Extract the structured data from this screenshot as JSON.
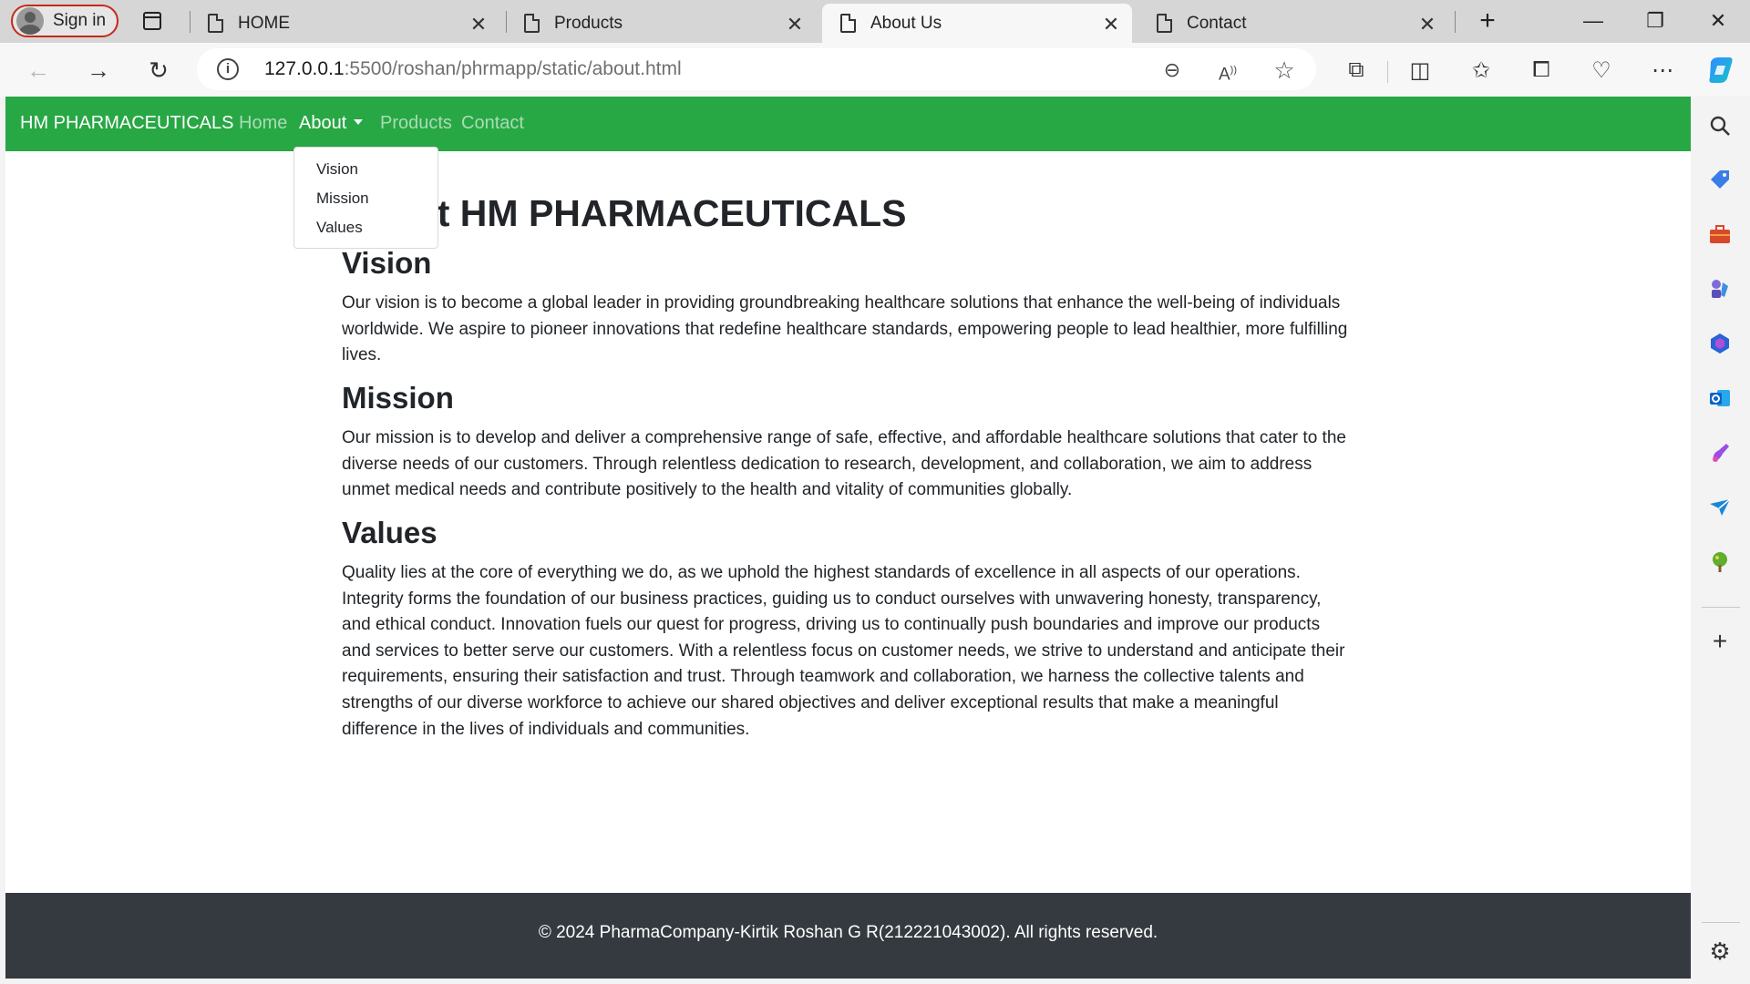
{
  "browser": {
    "profile_label": "Sign in",
    "tabs": [
      {
        "title": "HOME"
      },
      {
        "title": "Products"
      },
      {
        "title": "About Us"
      },
      {
        "title": "Contact"
      }
    ],
    "url_host": "127.0.0.1",
    "url_path": ":5500/roshan/phrmapp/static/about.html"
  },
  "site": {
    "brand": "HM PHARMACEUTICALS",
    "nav": {
      "home": "Home",
      "about": "About",
      "products": "Products",
      "contact": "Contact"
    },
    "dropdown": [
      "Vision",
      "Mission",
      "Values"
    ],
    "page_title": "About HM PHARMACEUTICALS",
    "sections": [
      {
        "heading": "Vision",
        "text": "Our vision is to become a global leader in providing groundbreaking healthcare solutions that enhance the well-being of individuals worldwide. We aspire to pioneer innovations that redefine healthcare standards, empowering people to lead healthier, more fulfilling lives."
      },
      {
        "heading": "Mission",
        "text": "Our mission is to develop and deliver a comprehensive range of safe, effective, and affordable healthcare solutions that cater to the diverse needs of our customers. Through relentless dedication to research, development, and collaboration, we aim to address unmet medical needs and contribute positively to the health and vitality of communities globally."
      },
      {
        "heading": "Values",
        "text": "Quality lies at the core of everything we do, as we uphold the highest standards of excellence in all aspects of our operations. Integrity forms the foundation of our business practices, guiding us to conduct ourselves with unwavering honesty, transparency, and ethical conduct. Innovation fuels our quest for progress, driving us to continually push boundaries and improve our products and services to better serve our customers. With a relentless focus on customer needs, we strive to understand and anticipate their requirements, ensuring their satisfaction and trust. Through teamwork and collaboration, we harness the collective talents and strengths of our diverse workforce to achieve our shared objectives and deliver exceptional results that make a meaningful difference in the lives of individuals and communities."
      }
    ],
    "footer": "© 2024 PharmaCompany-Kirtik Roshan G R(212221043002). All rights reserved."
  },
  "colors": {
    "navbar": "#28a745",
    "footer": "#343a40",
    "profile_border": "#c42b1c"
  }
}
